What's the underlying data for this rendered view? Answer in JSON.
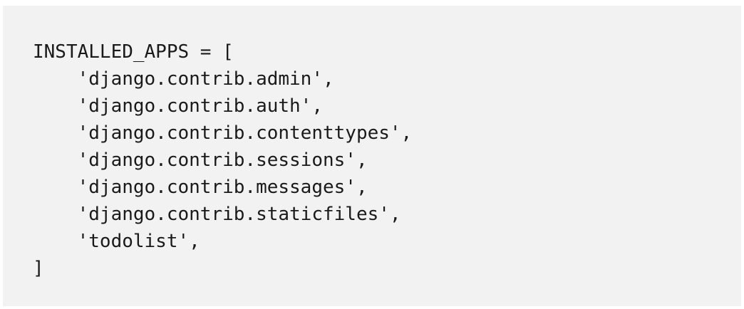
{
  "code": {
    "lines": [
      "INSTALLED_APPS = [",
      "'django.contrib.admin',",
      "'django.contrib.auth',",
      "'django.contrib.contenttypes',",
      "'django.contrib.sessions',",
      "'django.contrib.messages',",
      "'django.contrib.staticfiles',",
      "'todolist',",
      "]"
    ]
  }
}
